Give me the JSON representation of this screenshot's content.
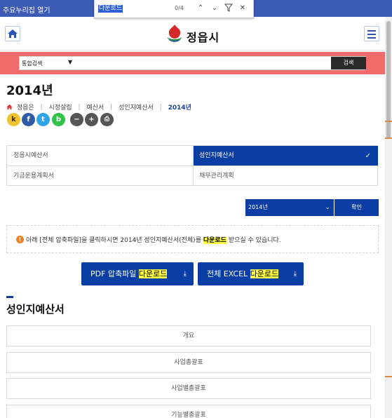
{
  "browser": {
    "window_title": "주요누리집 열기",
    "find_query": "다운로드",
    "find_count": "0/4"
  },
  "header": {
    "logo_text": "정읍시",
    "colors": {
      "primary": "#0b3ea4",
      "search_strip": "#f06b6b",
      "highlight": "#ffff44"
    }
  },
  "search": {
    "scope": "통합검색",
    "placeholder": "",
    "button_label": "검색"
  },
  "page": {
    "title": "2014년",
    "breadcrumb": [
      "정읍은",
      "시정살림",
      "예산서",
      "성인지예산서",
      "2014년"
    ]
  },
  "share": {
    "icons": [
      "kakaostory-icon",
      "facebook-icon",
      "twitter-icon",
      "band-icon",
      "zoom-out-icon",
      "zoom-in-icon",
      "print-icon"
    ],
    "labels": [
      "k",
      "f",
      "t",
      "b",
      "−",
      "+",
      "⎙"
    ]
  },
  "tabs": [
    {
      "label": "정읍시예산서",
      "active": false
    },
    {
      "label": "성인지예산서",
      "active": true
    },
    {
      "label": "기금운용계획서",
      "active": false
    },
    {
      "label": "채무관리계획",
      "active": false
    }
  ],
  "year_filter": {
    "selected": "2014년",
    "confirm_label": "확인"
  },
  "notice": {
    "prefix": "아래 [전체 압축파일]을 클릭하시면 2014년 성인지예산서(전체)를 ",
    "highlight": "다운로드",
    "suffix": " 받으실 수 있습니다."
  },
  "downloads": [
    {
      "prefix": "PDF 압축파일 ",
      "highlight": "다운로드"
    },
    {
      "prefix": "전체 EXCEL ",
      "highlight": "다운로드"
    }
  ],
  "section": {
    "title": "성인지예산서",
    "items": [
      "개요",
      "사업총괄표",
      "사업별총괄표",
      "기능별총괄표"
    ]
  }
}
